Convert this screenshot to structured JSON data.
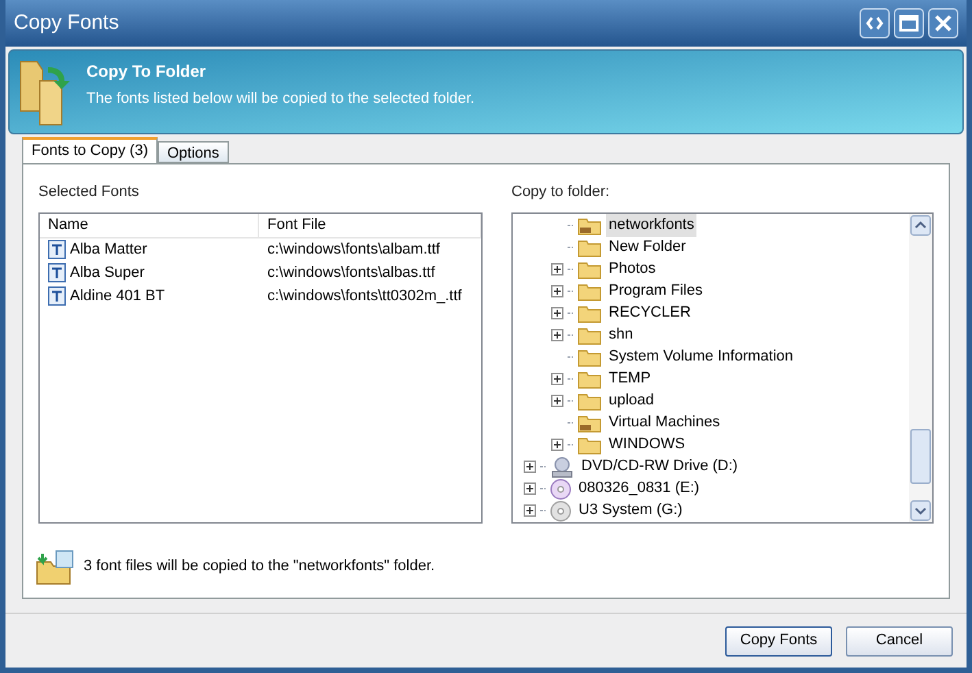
{
  "window": {
    "title": "Copy Fonts"
  },
  "header": {
    "title": "Copy To Folder",
    "subtitle": "The fonts listed below will be copied to the selected folder."
  },
  "tabs": [
    {
      "label": "Fonts to Copy (3)",
      "selected": true
    },
    {
      "label": "Options",
      "selected": false
    }
  ],
  "selected_fonts": {
    "label": "Selected Fonts",
    "columns": [
      "Name",
      "Font File"
    ],
    "rows": [
      {
        "name": "Alba Matter",
        "file": "c:\\windows\\fonts\\albam.ttf"
      },
      {
        "name": "Alba Super",
        "file": "c:\\windows\\fonts\\albas.ttf"
      },
      {
        "name": "Aldine 401 BT",
        "file": "c:\\windows\\fonts\\tt0302m_.ttf"
      }
    ]
  },
  "folder_tree": {
    "label": "Copy to folder:",
    "items": [
      {
        "children": [
          {
            "label": "networkfonts",
            "kind": "shared-folder",
            "expandable": false,
            "selected": true
          },
          {
            "label": "New Folder",
            "kind": "folder",
            "expandable": false,
            "selected": false
          },
          {
            "label": "Photos",
            "kind": "folder",
            "expandable": true,
            "selected": false
          },
          {
            "label": "Program Files",
            "kind": "folder",
            "expandable": true,
            "selected": false
          },
          {
            "label": "RECYCLER",
            "kind": "folder",
            "expandable": true,
            "selected": false
          },
          {
            "label": "shn",
            "kind": "folder",
            "expandable": true,
            "selected": false
          },
          {
            "label": "System Volume Information",
            "kind": "folder",
            "expandable": false,
            "selected": false
          },
          {
            "label": "TEMP",
            "kind": "folder",
            "expandable": true,
            "selected": false
          },
          {
            "label": "upload",
            "kind": "folder",
            "expandable": true,
            "selected": false
          },
          {
            "label": "Virtual Machines",
            "kind": "shared-folder",
            "expandable": false,
            "selected": false
          },
          {
            "label": "WINDOWS",
            "kind": "folder",
            "expandable": true,
            "selected": false
          }
        ]
      },
      {
        "label": "DVD/CD-RW Drive (D:)",
        "kind": "dvd-drive",
        "expandable": true,
        "selected": false
      },
      {
        "label": "080326_0831 (E:)",
        "kind": "disc",
        "expandable": true,
        "selected": false
      },
      {
        "label": "U3 System (G:)",
        "kind": "disc-grey",
        "expandable": true,
        "selected": false
      }
    ]
  },
  "message": "3 font files will be copied to the \"networkfonts\" folder.",
  "buttons": [
    "Copy Fonts",
    "Cancel"
  ]
}
